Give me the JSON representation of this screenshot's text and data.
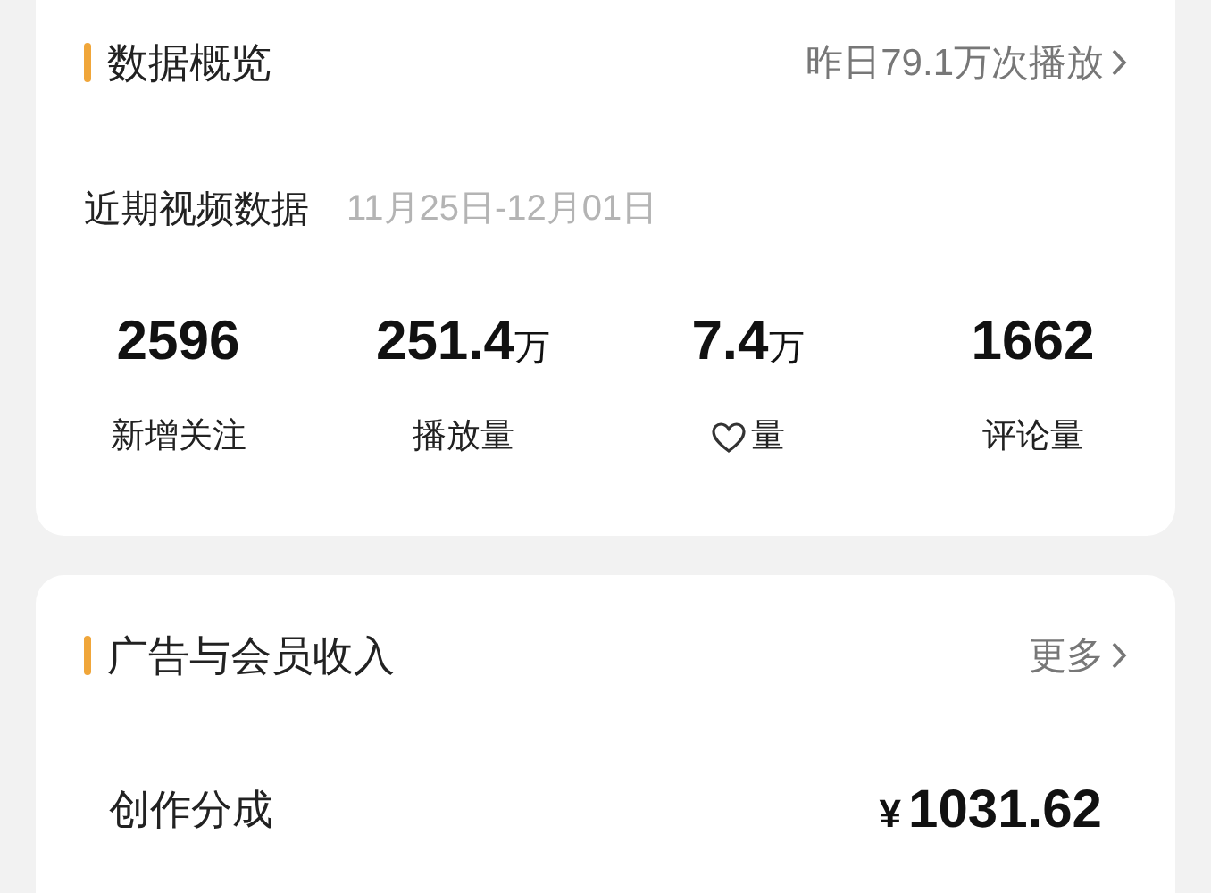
{
  "overview": {
    "title": "数据概览",
    "link": "昨日79.1万次播放",
    "subtitle": "近期视频数据",
    "date_range": "11月25日-12月01日",
    "stats": [
      {
        "kind": "plain",
        "value": "2596",
        "label": "新增关注"
      },
      {
        "kind": "plain",
        "value": "251.4",
        "unit": "万",
        "label": "播放量"
      },
      {
        "kind": "heart",
        "value": "7.4",
        "unit": "万",
        "label": "量"
      },
      {
        "kind": "plain",
        "value": "1662",
        "label": "评论量"
      }
    ]
  },
  "income": {
    "title": "广告与会员收入",
    "link": "更多",
    "rows": [
      {
        "label": "创作分成",
        "currency": "¥",
        "amount": "1031.62"
      }
    ]
  }
}
